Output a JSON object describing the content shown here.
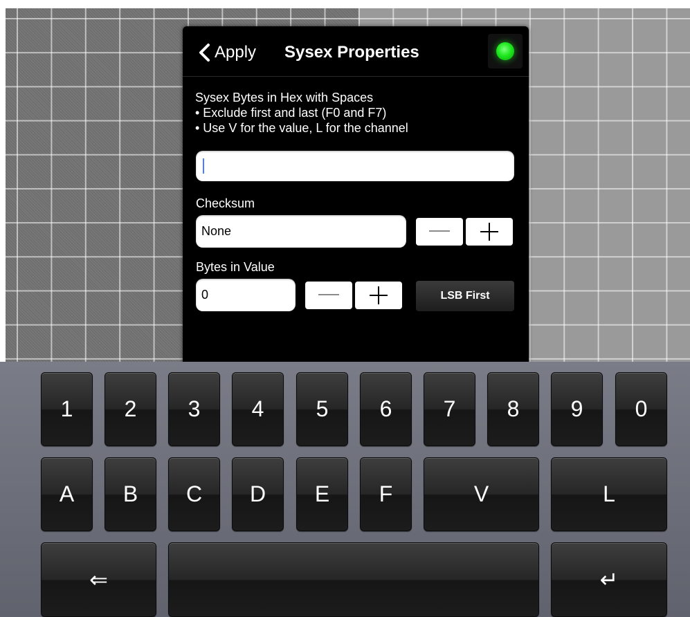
{
  "header": {
    "back_label": "Apply",
    "title": "Sysex Properties",
    "status_color": "#22dd22"
  },
  "instructions": {
    "line1": "Sysex Bytes in Hex with Spaces",
    "line2": "• Exclude first and last (F0 and F7)",
    "line3": "• Use V for the value, L for the channel"
  },
  "sysex_input": {
    "value": "",
    "placeholder": ""
  },
  "checksum": {
    "label": "Checksum",
    "value": "None"
  },
  "bytes_in_value": {
    "label": "Bytes in Value",
    "value": "0",
    "order_button": "LSB First"
  },
  "stepper": {
    "minus": "—",
    "plus": "+"
  },
  "keyboard": {
    "row1": [
      "1",
      "2",
      "3",
      "4",
      "5",
      "6",
      "7",
      "8",
      "9",
      "0"
    ],
    "row2": [
      "A",
      "B",
      "C",
      "D",
      "E",
      "F",
      "V",
      "L"
    ],
    "backspace": "⇐",
    "space": "",
    "enter": "↵"
  },
  "colors": {
    "panel_background": "#000000",
    "keyboard_background": "#6b6d78",
    "caret": "#4a7cff"
  }
}
